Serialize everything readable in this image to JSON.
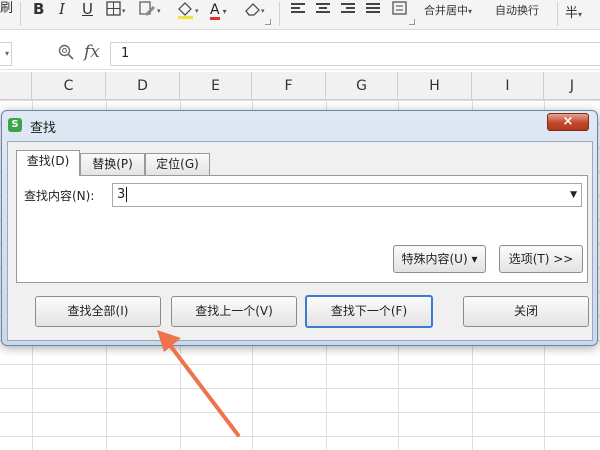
{
  "ribbon": {
    "partial_label": "刷",
    "bold": "B",
    "italic": "I",
    "underline": "U",
    "font_color": "A",
    "merge_center": "合并居中",
    "wrap_text": "自动换行",
    "currency": "半"
  },
  "formula_bar": {
    "fx": "fx",
    "value": "1"
  },
  "columns": [
    "C",
    "D",
    "E",
    "F",
    "G",
    "H",
    "I",
    "J"
  ],
  "dialog": {
    "icon_letter": "S",
    "title": "查找",
    "close": "×",
    "tabs": [
      {
        "label": "查找(D)",
        "active": true
      },
      {
        "label": "替换(P)",
        "active": false
      },
      {
        "label": "定位(G)",
        "active": false
      }
    ],
    "find_label": "查找内容(N):",
    "find_value": "3",
    "special_button": "特殊内容(U) ▾",
    "options_button": "选项(T) >>",
    "buttons": {
      "find_all": "查找全部(I)",
      "find_prev": "查找上一个(V)",
      "find_next": "查找下一个(F)",
      "close": "关闭"
    }
  },
  "colors": {
    "dialog_frame": "#c9d9ec",
    "close_button": "#c3462c",
    "annotation_arrow": "#f0734f",
    "focus_border": "#3d7bd0",
    "icon_green": "#3da34a"
  }
}
